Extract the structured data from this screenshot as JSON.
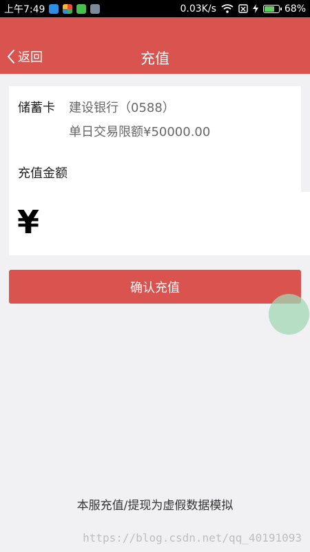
{
  "status_bar": {
    "time": "上午7:49",
    "network_speed": "0.03K/s",
    "battery": "68%",
    "icons": [
      "wifi-icon",
      "sim-blocked-icon",
      "charging-icon",
      "battery-icon"
    ]
  },
  "header": {
    "back_label": "返回",
    "title": "充值",
    "background_color": "#d9534f"
  },
  "card": {
    "label": "储蓄卡",
    "bank": "建设银行（0588）",
    "daily_limit": "单日交易限额¥50000.00",
    "amount_label": "充值金额",
    "currency_symbol": "¥",
    "amount_value": ""
  },
  "confirm_button": {
    "label": "确认充值"
  },
  "footer": {
    "disclaimer": "本服充值/提现为虚假数据模拟",
    "watermark": "https://blog.csdn.net/qq_40191093"
  }
}
